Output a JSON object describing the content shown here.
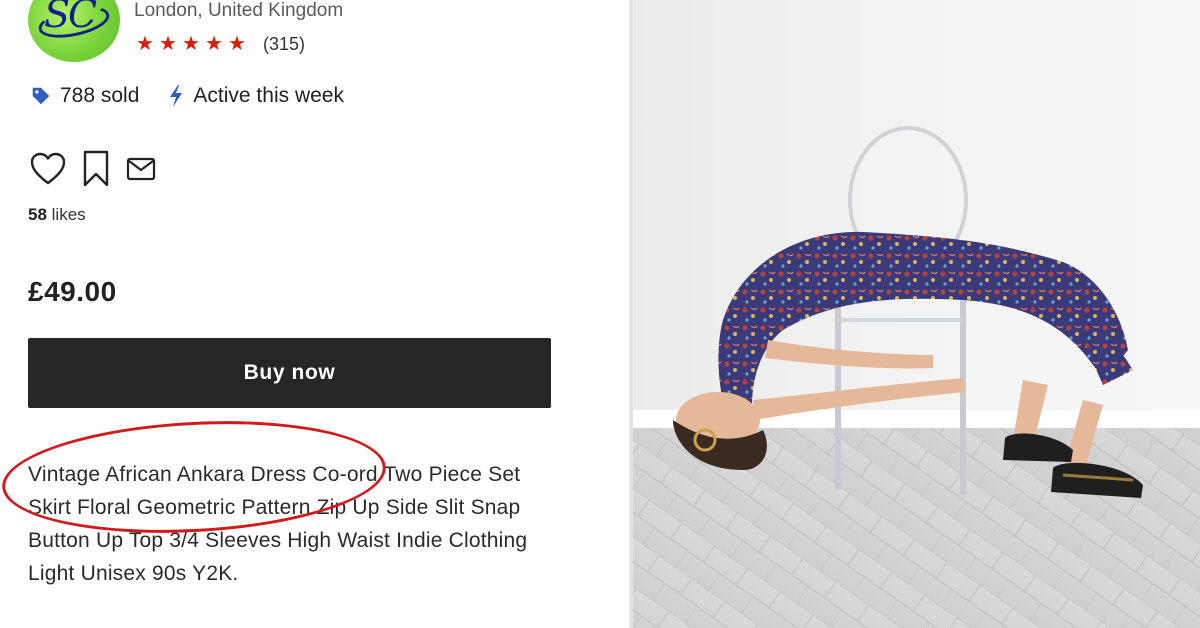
{
  "seller": {
    "avatar_text": "SC",
    "location": "London, United Kingdom",
    "rating_stars": 5,
    "review_count": "(315)"
  },
  "stats": {
    "sold": "788 sold",
    "activity": "Active this week"
  },
  "actions": {
    "like_icon": "heart-icon",
    "save_icon": "bookmark-icon",
    "message_icon": "envelope-icon"
  },
  "likes": {
    "count": "58",
    "label": " likes"
  },
  "price": "£49.00",
  "buy_button": "Buy now",
  "description": "Vintage African Ankara Dress Co-ord Two Piece Set Skirt Floral Geometric Pattern Zip Up Side Slit Snap Button Up Top 3/4 Sleeves High Waist Indie Clothing Light Unisex 90s Y2K.",
  "colors": {
    "accent_red": "#d81e05",
    "button_bg": "#262626",
    "icon_blue": "#2f5fbf",
    "annotation_red": "#d11a1a"
  }
}
